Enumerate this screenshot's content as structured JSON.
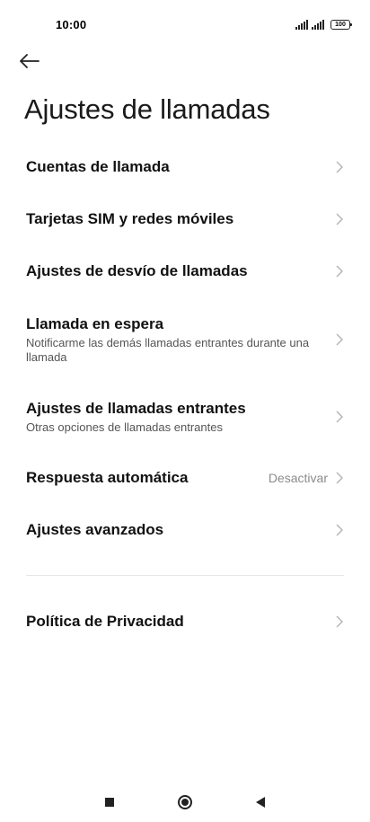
{
  "status_bar": {
    "time": "10:00",
    "battery": "100"
  },
  "header": {
    "title": "Ajustes de llamadas"
  },
  "items": [
    {
      "title": "Cuentas de llamada",
      "subtitle": "",
      "value": ""
    },
    {
      "title": "Tarjetas SIM y redes móviles",
      "subtitle": "",
      "value": ""
    },
    {
      "title": "Ajustes de desvío de llamadas",
      "subtitle": "",
      "value": ""
    },
    {
      "title": "Llamada en espera",
      "subtitle": "Notificarme las demás llamadas entrantes durante una llamada",
      "value": ""
    },
    {
      "title": "Ajustes de llamadas entrantes",
      "subtitle": "Otras opciones de llamadas entrantes",
      "value": ""
    },
    {
      "title": "Respuesta automática",
      "subtitle": "",
      "value": "Desactivar"
    },
    {
      "title": "Ajustes avanzados",
      "subtitle": "",
      "value": ""
    },
    {
      "title": "Política de Privacidad",
      "subtitle": "",
      "value": ""
    }
  ],
  "icons": {
    "back": "back-arrow-icon",
    "chevron": "chevron-right-icon"
  },
  "colors": {
    "background": "#ffffff",
    "text": "#111111",
    "secondary_text": "#8c8c8c"
  }
}
